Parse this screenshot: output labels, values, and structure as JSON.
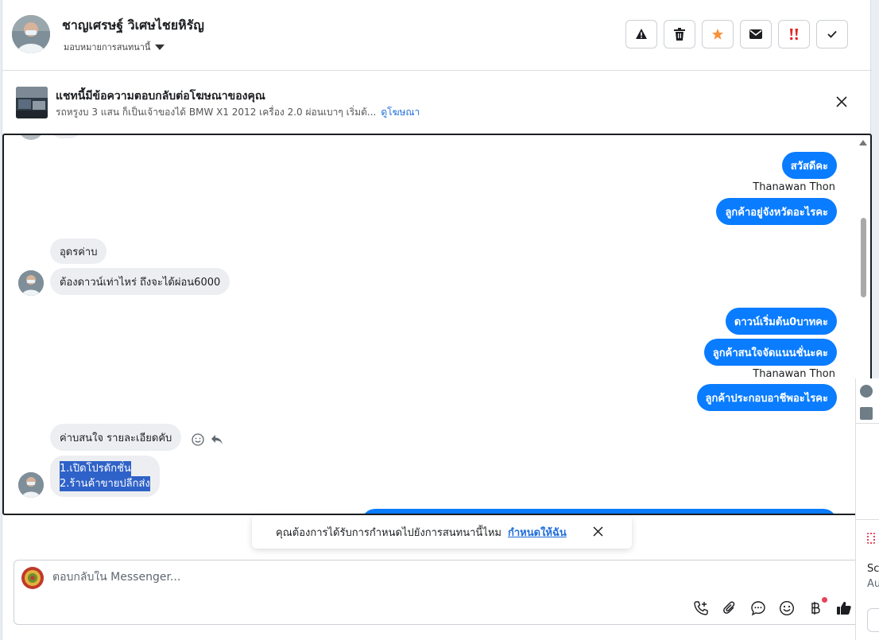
{
  "header": {
    "contact_name": "ชาญเศรษฐ์ วิเศษไชยหิรัญ",
    "assign_label": "มอบหมายการสนทนานี้"
  },
  "ad": {
    "title": "แชทนี้มีข้อความตอบกลับต่อโฆษณาของคุณ",
    "description": "รถหรูงบ 3 แสน ก็เป็นเจ้าของได้ BMW X1 2012 เครื่อง 2.0 ผ่อนเบาๆ เริ่มต้...",
    "link_label": "ดูโฆษณา"
  },
  "messages": {
    "out_1": "สวัสดีคะ",
    "sender_1": "Thanawan Thon",
    "out_2": "ลูกค้าอยู่จังหวัดอะไรคะ",
    "in_1": "อุดรค่าบ",
    "in_2": "ต้องดาวน์เท่าไหร่ ถึงจะได้ผ่อน6000",
    "out_3": "ดาวน์เริ่มต้น0บาทคะ",
    "out_4": "ลูกค้าสนใจจัดแนนชั่นะคะ",
    "sender_2": "Thanawan Thon",
    "out_5": "ลูกค้าประกอบอาชีพอะไรคะ",
    "in_3": "ค่าบสนใจ รายละเอียดคับ",
    "in_4_line1": "1.เปิดโปรดักชั่น",
    "in_4_line2": "2.ร้านค้าขายปลีกส่ง"
  },
  "toast": {
    "text": "คุณต้องการได้รับการกำหนดไปยังการสนทนานี้ไหม",
    "link_label": "กำหนดให้ฉัน"
  },
  "composer": {
    "placeholder": "ตอบกลับใน Messenger..."
  },
  "side_panel": {
    "text_1": "Sc",
    "text_2": "Au"
  },
  "colors": {
    "outgoing_bubble": "#0a7cff",
    "incoming_bubble": "#eceef1",
    "link": "#216fdb",
    "star": "#f7923b",
    "report": "#e02424"
  }
}
